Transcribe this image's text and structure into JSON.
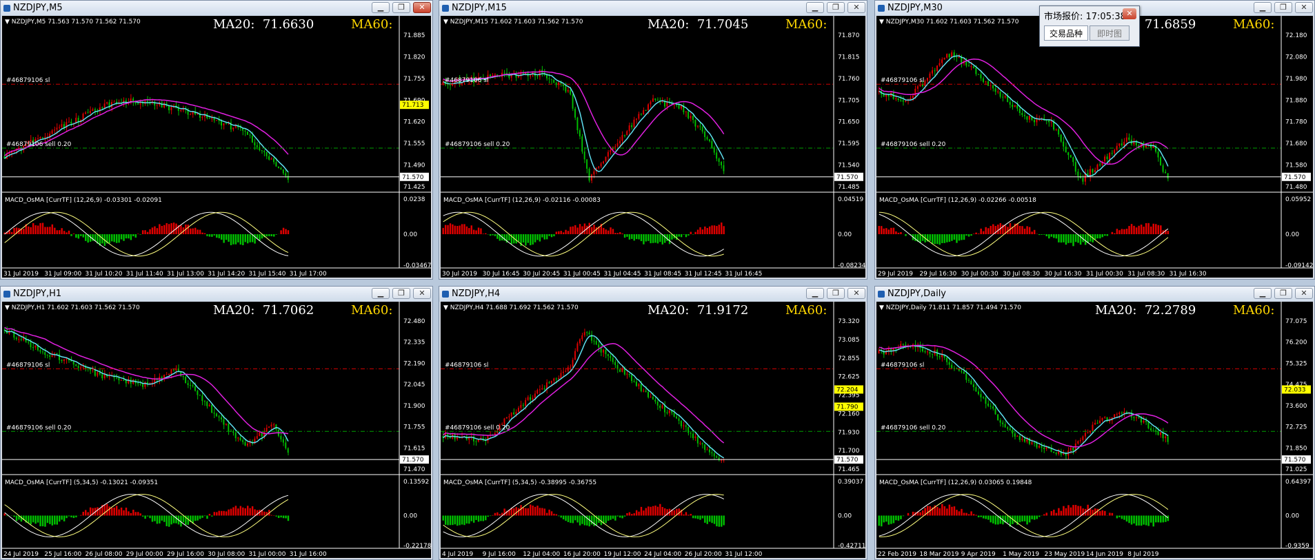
{
  "popup": {
    "title": "市场报价: 17:05:38",
    "close_icon": "close-icon",
    "tabs": [
      "交易品种",
      "即时图"
    ]
  },
  "window_controls": {
    "minimize_icon": "minimize-icon",
    "restore_icon": "restore-icon",
    "close_icon": "close-icon"
  },
  "colors": {
    "bullish": "#00c000",
    "bearish": "#e00000",
    "ma_cyan": "#5fe0f0",
    "ma_magenta": "#e020e0",
    "ma60_label": "#ffd700"
  },
  "windows": [
    {
      "id": "m5",
      "title": "NZDJPY,M5",
      "info": "▼ NZDJPY,M5  71.563 71.570 71.562 71.570",
      "ma20_label": "MA20:",
      "ma20_value": "71.6630",
      "ma60_label": "MA60:",
      "price_axis": [
        "71.885",
        "71.820",
        "71.755",
        "71.690",
        "71.620",
        "71.555",
        "71.490",
        "71.425"
      ],
      "sl_label": "#46879106 sl",
      "sell_label": "#46879106 sell 0.20",
      "tags": [
        {
          "text": "71.713",
          "color": "#ffff00",
          "fg": "#000"
        },
        {
          "text": "71.570",
          "color": "#ffffff",
          "fg": "#000"
        }
      ],
      "macd_label": "MACD_OsMA [CurrTF] (12,26,9) -0.03301 -0.02091",
      "macd_axis": [
        "0.0238",
        "0.00",
        "-0.03467"
      ],
      "time_axis": [
        "31 Jul 2019",
        "31 Jul 09:00",
        "31 Jul 10:20",
        "31 Jul 11:40",
        "31 Jul 13:00",
        "31 Jul 14:20",
        "31 Jul 15:40",
        "31 Jul 17:00"
      ]
    },
    {
      "id": "m15",
      "title": "NZDJPY,M15",
      "info": "▼ NZDJPY,M15  71.602 71.603 71.562 71.570",
      "ma20_label": "MA20:",
      "ma20_value": "71.7045",
      "ma60_label": "MA60:",
      "price_axis": [
        "71.870",
        "71.815",
        "71.760",
        "71.705",
        "71.650",
        "71.595",
        "71.540",
        "71.485"
      ],
      "sl_label": "#46879106 sl",
      "sell_label": "#46879106 sell 0.20",
      "tags": [
        {
          "text": "71.570",
          "color": "#ffffff",
          "fg": "#000"
        }
      ],
      "macd_label": "MACD_OsMA [CurrTF] (12,26,9) -0.02116 -0.00083",
      "macd_axis": [
        "0.04519",
        "0.00",
        "-0.08234"
      ],
      "time_axis": [
        "30 Jul 2019",
        "30 Jul 16:45",
        "30 Jul 20:45",
        "31 Jul 00:45",
        "31 Jul 04:45",
        "31 Jul 08:45",
        "31 Jul 12:45",
        "31 Jul 16:45"
      ]
    },
    {
      "id": "m30",
      "title": "NZDJPY,M30",
      "info": "▼ NZDJPY,M30  71.602 71.603 71.562 71.570",
      "ma20_label": "MA20:",
      "ma20_value": "71.6859",
      "ma60_label": "MA60:",
      "price_axis": [
        "72.180",
        "72.080",
        "71.980",
        "71.880",
        "71.780",
        "71.680",
        "71.580",
        "71.480"
      ],
      "sl_label": "#46879106 sl",
      "sell_label": "#46879106 sell 0.20",
      "tags": [
        {
          "text": "71.570",
          "color": "#ffffff",
          "fg": "#000"
        }
      ],
      "macd_label": "MACD_OsMA [CurrTF] (12,26,9) -0.02266 -0.00518",
      "macd_axis": [
        "0.05952",
        "0.00",
        "-0.09142"
      ],
      "time_axis": [
        "29 Jul 2019",
        "29 Jul 16:30",
        "30 Jul 00:30",
        "30 Jul 08:30",
        "30 Jul 16:30",
        "31 Jul 00:30",
        "31 Jul 08:30",
        "31 Jul 16:30"
      ]
    },
    {
      "id": "h1",
      "title": "NZDJPY,H1",
      "info": "▼ NZDJPY,H1  71.602 71.603 71.562 71.570",
      "ma20_label": "MA20:",
      "ma20_value": "71.7062",
      "ma60_label": "MA60:",
      "price_axis": [
        "72.480",
        "72.335",
        "72.190",
        "72.045",
        "71.900",
        "71.755",
        "71.615",
        "71.470"
      ],
      "sl_label": "#46879106 sl",
      "sell_label": "#46879106 sell 0.20",
      "tags": [
        {
          "text": "71.570",
          "color": "#ffffff",
          "fg": "#000"
        }
      ],
      "macd_label": "MACD_OsMA [CurrTF] (5,34,5) -0.13021 -0.09351",
      "macd_axis": [
        "0.13592",
        "0.00",
        "-0.22178"
      ],
      "time_axis": [
        "24 Jul 2019",
        "25 Jul 16:00",
        "26 Jul 08:00",
        "29 Jul 00:00",
        "29 Jul 16:00",
        "30 Jul 08:00",
        "31 Jul 00:00",
        "31 Jul 16:00"
      ]
    },
    {
      "id": "h4",
      "title": "NZDJPY,H4",
      "info": "▼ NZDJPY,H4  71.688 71.692 71.562 71.570",
      "ma20_label": "MA20:",
      "ma20_value": "71.9172",
      "ma60_label": "MA60:",
      "price_axis": [
        "73.320",
        "73.085",
        "72.855",
        "72.625",
        "72.395",
        "72.160",
        "71.930",
        "71.700",
        "71.465"
      ],
      "sl_label": "#46879106 sl",
      "sell_label": "#46879106 sell 0.20",
      "tags": [
        {
          "text": "72.204",
          "color": "#ffff00",
          "fg": "#000"
        },
        {
          "text": "71.790",
          "color": "#ffff00",
          "fg": "#000"
        },
        {
          "text": "71.570",
          "color": "#ffffff",
          "fg": "#000"
        }
      ],
      "macd_label": "MACD_OsMA [CurrTF] (5,34,5) -0.38995 -0.36755",
      "macd_axis": [
        "0.39037",
        "0.00",
        "-0.42711"
      ],
      "time_axis": [
        "4 Jul 2019",
        "9 Jul 16:00",
        "12 Jul 04:00",
        "16 Jul 20:00",
        "19 Jul 12:00",
        "24 Jul 04:00",
        "26 Jul 20:00",
        "31 Jul 12:00"
      ]
    },
    {
      "id": "daily",
      "title": "NZDJPY,Daily",
      "info": "▼ NZDJPY,Daily  71.811 71.857 71.494 71.570",
      "ma20_label": "MA20:",
      "ma20_value": "72.2789",
      "ma60_label": "MA60:",
      "price_axis": [
        "77.075",
        "76.200",
        "75.325",
        "74.475",
        "73.600",
        "72.725",
        "71.850",
        "71.025"
      ],
      "sl_label": "#46879106 sl",
      "sell_label": "#46879106 sell 0.20",
      "tags": [
        {
          "text": "72.033",
          "color": "#ffff00",
          "fg": "#000"
        },
        {
          "text": "71.570",
          "color": "#ffffff",
          "fg": "#000"
        }
      ],
      "macd_label": "MACD_OsMA [CurrTF] (12,26,9) 0.03065 0.19848",
      "macd_axis": [
        "0.64397",
        "0.00",
        "-0.9359"
      ],
      "time_axis": [
        "22 Feb 2019",
        "18 Mar 2019",
        "9 Apr 2019",
        "1 May 2019",
        "23 May 2019",
        "14 Jun 2019",
        "8 Jul 2019",
        ""
      ]
    }
  ]
}
